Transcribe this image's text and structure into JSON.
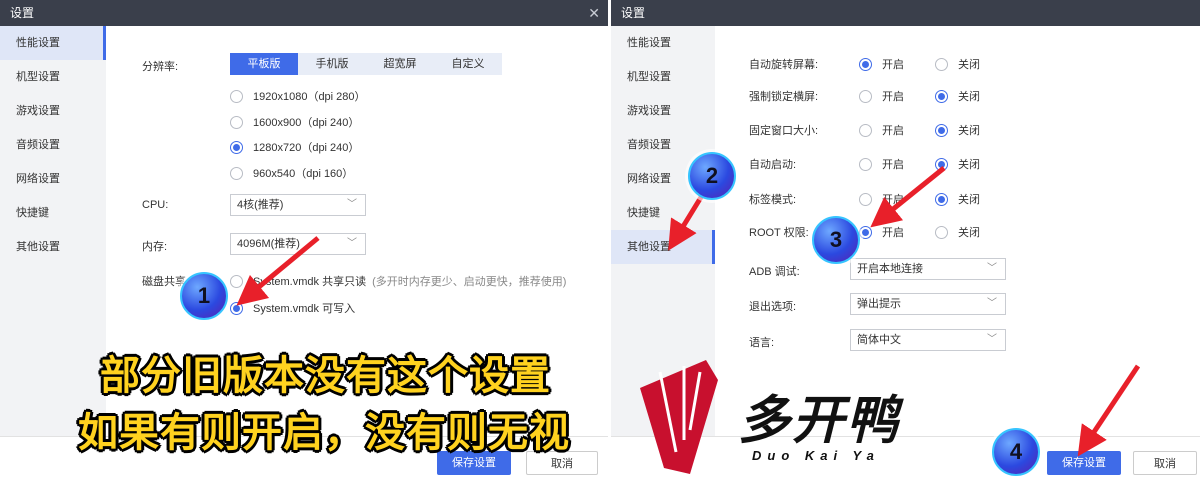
{
  "left": {
    "title": "设置",
    "sidebar": [
      "性能设置",
      "机型设置",
      "游戏设置",
      "音频设置",
      "网络设置",
      "快捷键",
      "其他设置"
    ],
    "resolution_label": "分辨率:",
    "tabs": [
      "平板版",
      "手机版",
      "超宽屏",
      "自定义"
    ],
    "resolutions": [
      "1920x1080（dpi 280）",
      "1600x900（dpi 240）",
      "1280x720（dpi 240）",
      "960x540（dpi 160）"
    ],
    "selected_resolution": 2,
    "cpu_label": "CPU:",
    "cpu_value": "4核(推荐)",
    "memory_label": "内存:",
    "memory_value": "4096M(推荐)",
    "disk_label": "磁盘共享",
    "disk_opt1": "System.vmdk 共享只读",
    "disk_opt1_hint": "(多开时内存更少、启动更快，推荐使用)",
    "disk_opt2": "System.vmdk 可写入",
    "save": "保存设置",
    "cancel": "取消"
  },
  "right": {
    "title": "设置",
    "sidebar": [
      "性能设置",
      "机型设置",
      "游戏设置",
      "音频设置",
      "网络设置",
      "快捷键",
      "其他设置"
    ],
    "rows": [
      {
        "label": "自动旋转屏幕:",
        "on_selected": true
      },
      {
        "label": "强制锁定横屏:",
        "on_selected": false
      },
      {
        "label": "固定窗口大小:",
        "on_selected": false
      },
      {
        "label": "自动启动:",
        "on_selected": false
      },
      {
        "label": "标签模式:",
        "on_selected": false
      },
      {
        "label": "ROOT 权限:",
        "on_selected": true
      }
    ],
    "on": "开启",
    "off": "关闭",
    "adb_label": "ADB 调试:",
    "adb_value": "开启本地连接",
    "exit_label": "退出选项:",
    "exit_value": "弹出提示",
    "lang_label": "语言:",
    "lang_value": "简体中文",
    "save": "保存设置",
    "cancel": "取消"
  },
  "caption": {
    "line1": "部分旧版本没有这个设置",
    "line2": "如果有则开启，没有则无视"
  },
  "logo": {
    "main": "多开鸭",
    "sub": "Duo Kai Ya"
  },
  "badges": [
    "1",
    "2",
    "3",
    "4"
  ],
  "colors": {
    "accent": "#3f6be8",
    "titlebar": "#3a3f4b",
    "caption": "#ffd21f",
    "arrow": "#e8202a",
    "logo_red": "#c8102e"
  }
}
